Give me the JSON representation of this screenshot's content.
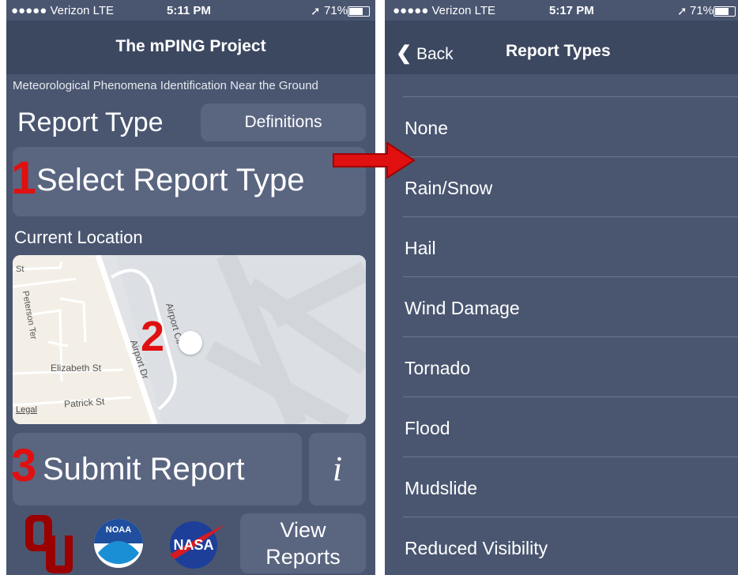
{
  "left_screen": {
    "status": {
      "carrier": "●●●●● Verizon  LTE",
      "time": "5:11 PM",
      "battery": "71%"
    },
    "nav_title": "The mPING Project",
    "subtitle": "Meteorological Phenomena Identification Near the Ground",
    "report_type_label": "Report Type",
    "definitions_label": "Definitions",
    "select_report_type_label": "Select Report Type",
    "current_location_label": "Current Location",
    "map": {
      "streets": [
        "St",
        "Peterson Ter",
        "Elizabeth St",
        "Patrick St",
        "Airport Dr",
        "Airport Cir"
      ],
      "legal": "Legal"
    },
    "submit_label": "Submit Report",
    "info_label": "i",
    "view_reports_line1": "View",
    "view_reports_line2": "Reports",
    "logos": {
      "ou": "OU",
      "noaa": "NOAA",
      "nasa": "NASA"
    }
  },
  "annotations": {
    "step1": "1",
    "step2": "2",
    "step3": "3"
  },
  "right_screen": {
    "status": {
      "carrier": "●●●●● Verizon  LTE",
      "time": "5:17 PM",
      "battery": "71%"
    },
    "back_label": "Back",
    "nav_title": "Report Types",
    "report_types": [
      "None",
      "Rain/Snow",
      "Hail",
      "Wind Damage",
      "Tornado",
      "Flood",
      "Mudslide",
      "Reduced Visibility"
    ]
  },
  "colors": {
    "panel": "#4a5670",
    "navbar": "#3c4860",
    "button": "#5a6580",
    "annotation_red": "#e01010"
  }
}
